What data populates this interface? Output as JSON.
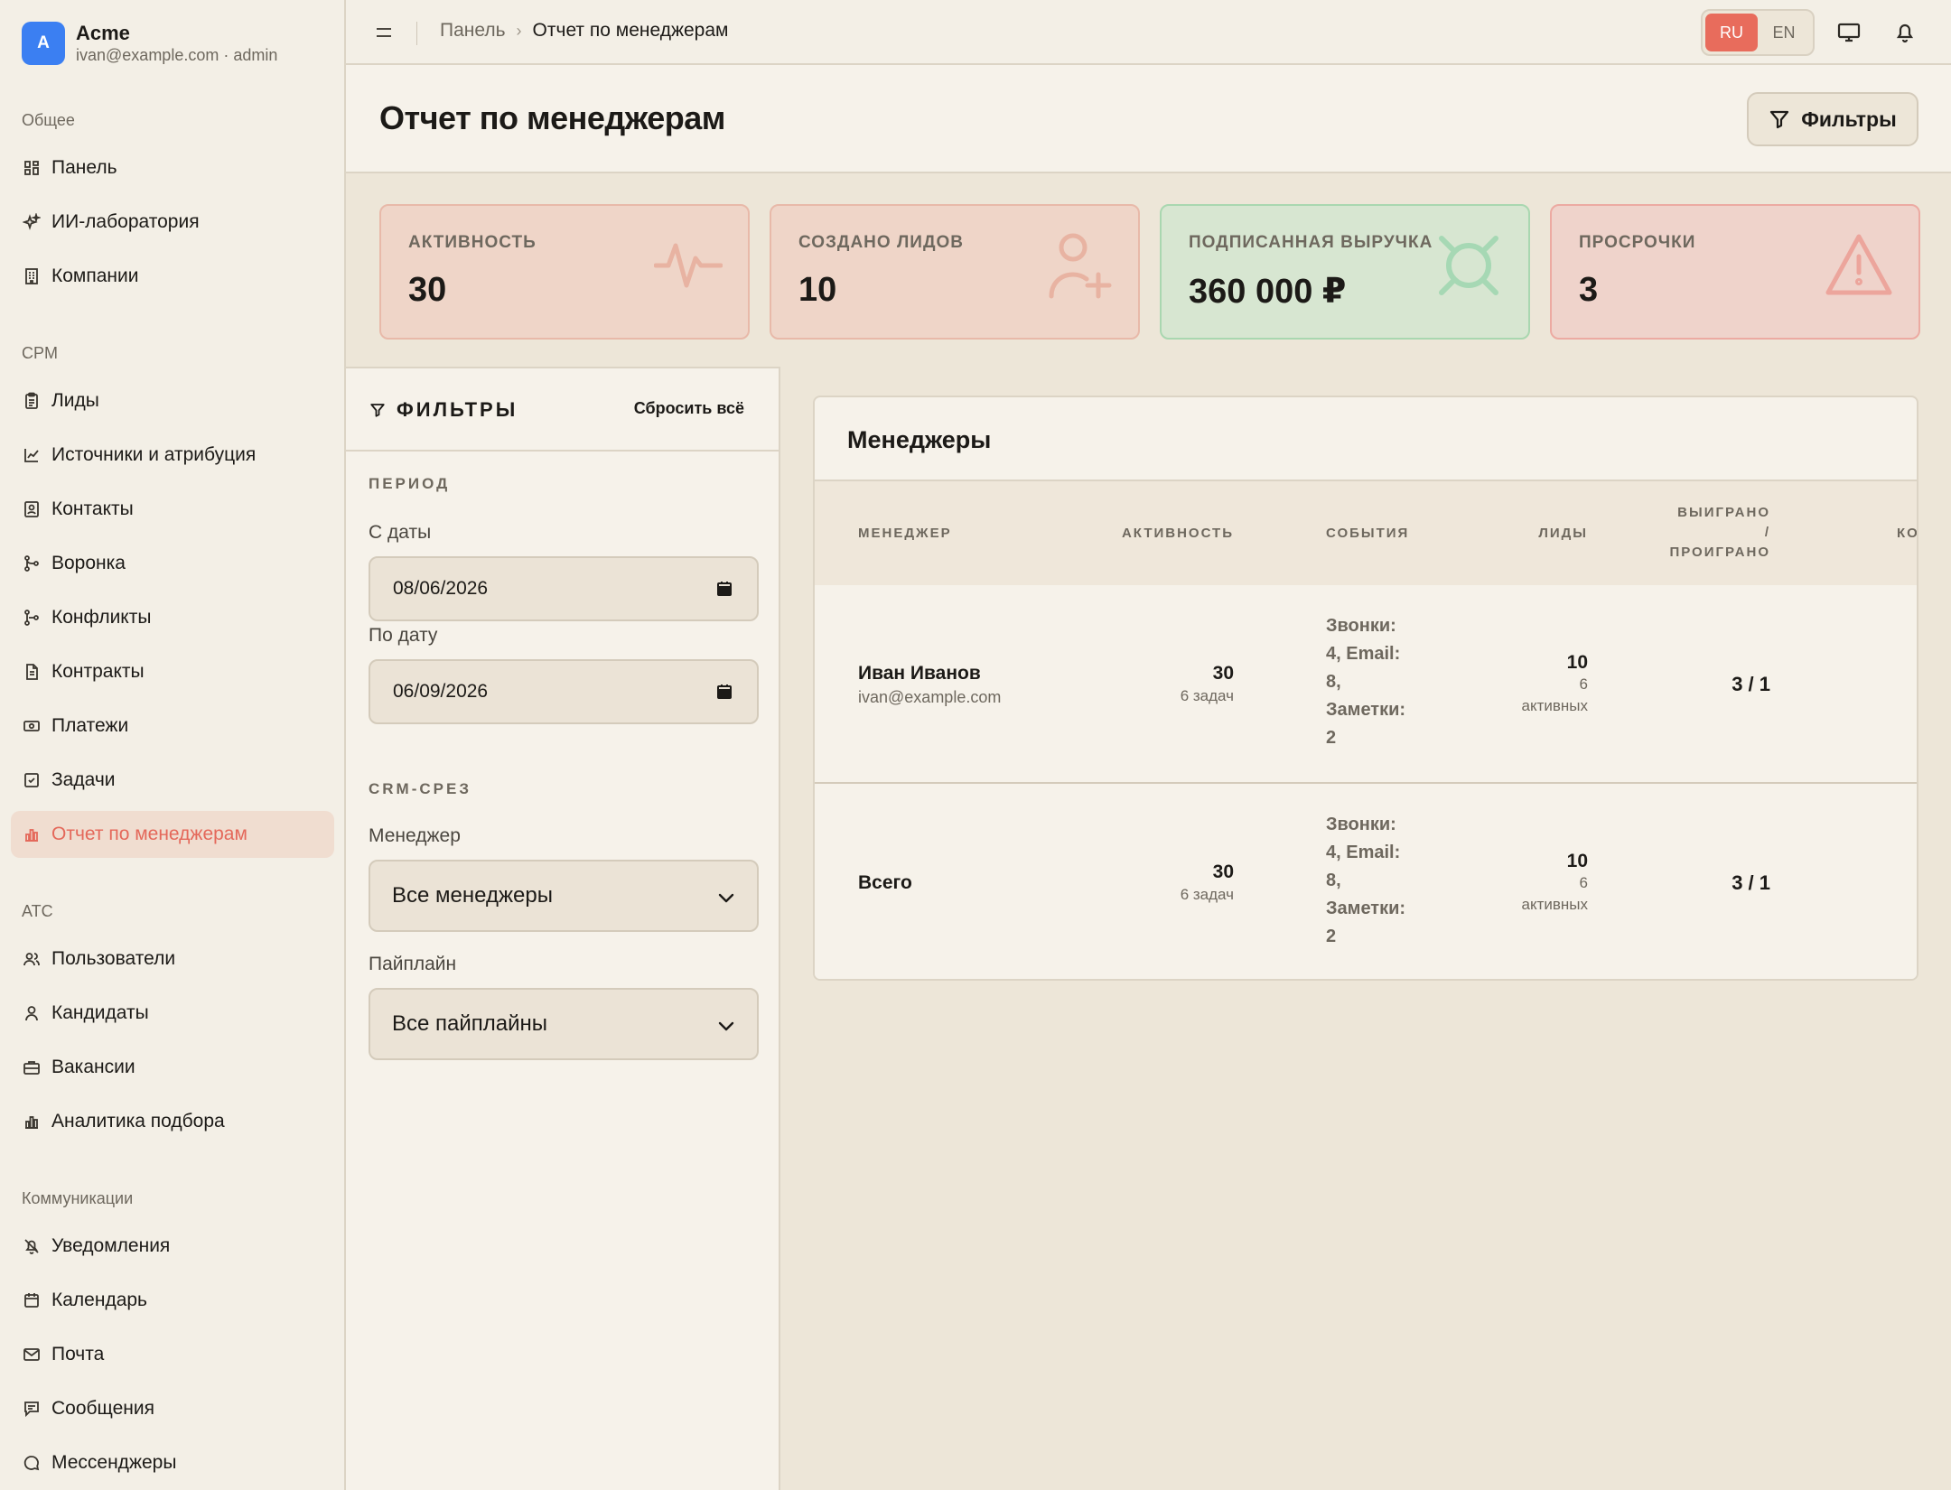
{
  "brand": {
    "initial": "A",
    "name": "Acme",
    "email": "ivan@example.com · admin"
  },
  "nav": {
    "sections": {
      "general": "Общее",
      "crm": "CPM",
      "ats": "ATC",
      "communications": "Коммуникации"
    },
    "general": [
      {
        "label": "Панель",
        "icon": "grid-icon"
      },
      {
        "label": "ИИ-лаборатория",
        "icon": "sparkles-icon"
      },
      {
        "label": "Компании",
        "icon": "building-icon"
      }
    ],
    "crm": [
      {
        "label": "Лиды",
        "icon": "clipboard-icon"
      },
      {
        "label": "Источники и атрибуция",
        "icon": "line-chart-icon"
      },
      {
        "label": "Контакты",
        "icon": "contact-book-icon"
      },
      {
        "label": "Воронка",
        "icon": "git-merge-icon"
      },
      {
        "label": "Конфликты",
        "icon": "git-branch-icon"
      },
      {
        "label": "Контракты",
        "icon": "file-text-icon"
      },
      {
        "label": "Платежи",
        "icon": "banknote-icon"
      },
      {
        "label": "Задачи",
        "icon": "check-square-icon"
      },
      {
        "label": "Отчет по менеджерам",
        "icon": "bar-chart-icon",
        "active": true
      }
    ],
    "ats": [
      {
        "label": "Пользователи",
        "icon": "users-icon"
      },
      {
        "label": "Кандидаты",
        "icon": "user-icon"
      },
      {
        "label": "Вакансии",
        "icon": "briefcase-icon"
      },
      {
        "label": "Аналитика подбора",
        "icon": "bar-chart-icon"
      }
    ],
    "communications": [
      {
        "label": "Уведомления",
        "icon": "bell-off-icon"
      },
      {
        "label": "Календарь",
        "icon": "calendar-icon"
      },
      {
        "label": "Почта",
        "icon": "mail-icon"
      },
      {
        "label": "Сообщения",
        "icon": "message-square-icon"
      },
      {
        "label": "Мессенджеры",
        "icon": "message-circle-icon"
      }
    ]
  },
  "topbar": {
    "breadcrumb_home": "Панель",
    "breadcrumb_sep": "›",
    "breadcrumb_current": "Отчет по менеджерам",
    "lang_ru": "RU",
    "lang_en": "EN",
    "accent": "#e86c5c"
  },
  "header": {
    "title": "Отчет по менеджерам",
    "filters_button": "Фильтры"
  },
  "kpis": [
    {
      "label": "АКТИВНОСТЬ",
      "value": "30",
      "icon": "activity-icon",
      "tone": "peach"
    },
    {
      "label": "СОЗДАНО ЛИДОВ",
      "value": "10",
      "icon": "user-plus-icon",
      "tone": "peach"
    },
    {
      "label": "ПОДПИСАННАЯ ВЫРУЧКА",
      "value": "360 000 ₽",
      "icon": "currency-icon",
      "tone": "green"
    },
    {
      "label": "ПРОСРОЧКИ",
      "value": "3",
      "icon": "warning-icon",
      "tone": "red"
    }
  ],
  "filters": {
    "title": "ФИЛЬТРЫ",
    "reset": "Сбросить всё",
    "period_section": "ПЕРИОД",
    "from_label": "С даты",
    "from_value": "08/06/2026",
    "to_label": "По дату",
    "to_value": "06/09/2026",
    "crm_section": "CRM-СРЕЗ",
    "manager_label": "Менеджер",
    "manager_value": "Все менеджеры",
    "pipeline_label": "Пайплайн",
    "pipeline_value": "Все пайплайны"
  },
  "table": {
    "title": "Менеджеры",
    "columns": {
      "manager": "МЕНЕДЖЕР",
      "activity": "АКТИВНОСТЬ",
      "events": "СОБЫТИЯ",
      "leads": "ЛИДЫ",
      "won_1": "ВЫИГРАНО",
      "won_2": "/",
      "won_3": "ПРОИГРАНО",
      "next": "КО"
    },
    "rows": [
      {
        "name": "Иван Иванов",
        "email": "ivan@example.com",
        "activity": "30",
        "activity_sub": "6 задач",
        "events": [
          "Звонки:",
          "4, Email:",
          "8,",
          "Заметки:",
          "2"
        ],
        "leads": "10",
        "leads_sub_1": "6",
        "leads_sub_2": "активных",
        "won_lost": "3 / 1"
      },
      {
        "name": "Всего",
        "activity": "30",
        "activity_sub": "6 задач",
        "events": [
          "Звонки:",
          "4, Email:",
          "8,",
          "Заметки:",
          "2"
        ],
        "leads": "10",
        "leads_sub_1": "6",
        "leads_sub_2": "активных",
        "won_lost": "3 / 1"
      }
    ]
  }
}
